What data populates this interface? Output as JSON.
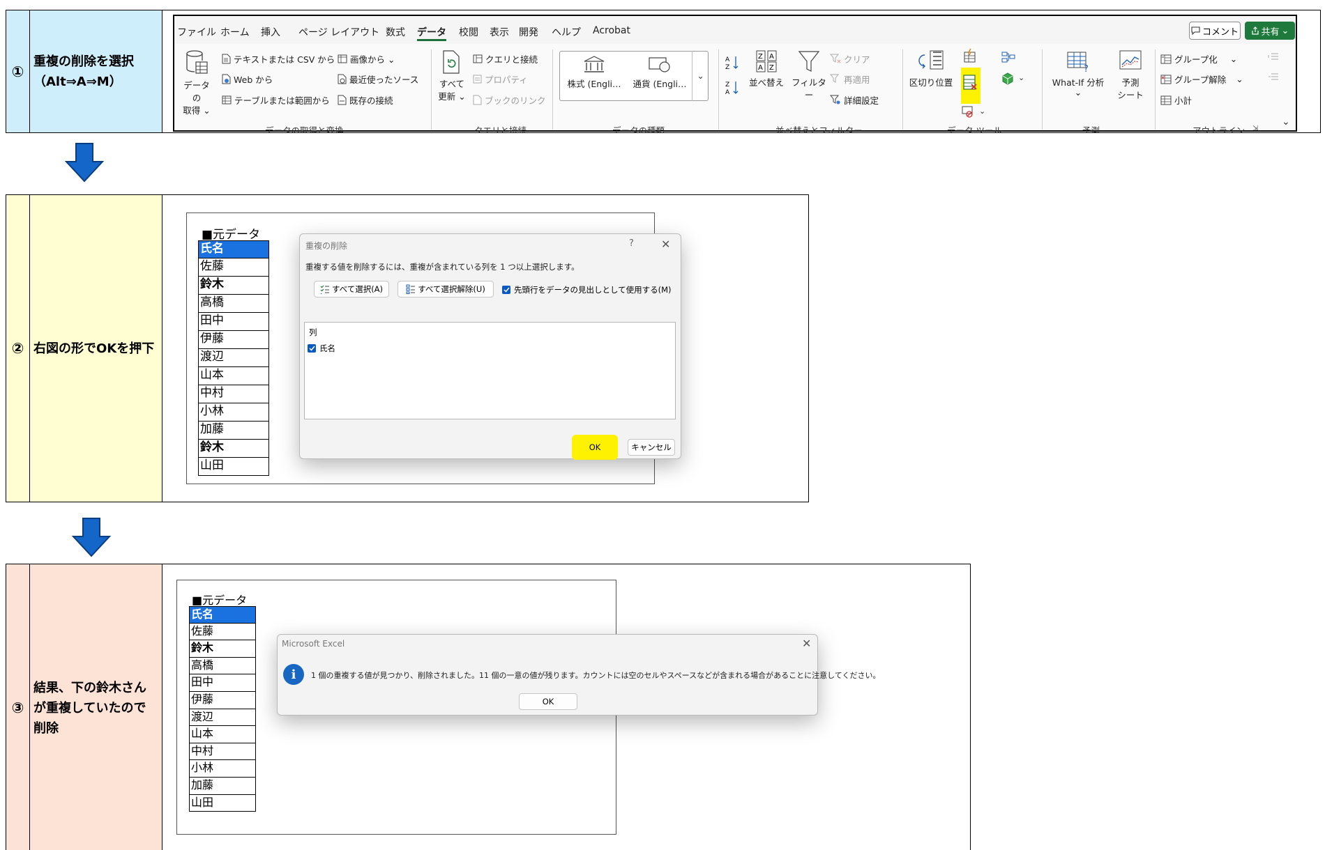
{
  "steps": [
    {
      "num": "①",
      "desc": [
        "重複の削除を選択",
        "（Alt⇒A⇒M）"
      ],
      "bg": "#cdeefa"
    },
    {
      "num": "②",
      "desc": [
        "右図の形でOKを押下"
      ],
      "bg": "#fefed2"
    },
    {
      "num": "③",
      "desc": [
        "結果、下の鈴木さん",
        "が重複していたので",
        "削除"
      ],
      "bg": "#fde2d6"
    }
  ],
  "ribbon": {
    "tabs": [
      "ファイル",
      "ホーム",
      "挿入",
      "ページ レイアウト",
      "数式",
      "データ",
      "校閲",
      "表示",
      "開発",
      "ヘルプ",
      "Acrobat"
    ],
    "active_tab": "データ",
    "comment_label": "コメント",
    "share_label": "共有",
    "get_data": {
      "label1": "データの",
      "label2": "取得 ⌄",
      "text_csv": "テキストまたは CSV から",
      "web": "Web から",
      "table_range": "テーブルまたは範囲から",
      "from_image": "画像から ⌄",
      "recent_sources": "最近使ったソース",
      "existing_conn": "既存の接続",
      "group": "データの取得と変換"
    },
    "queries": {
      "refresh1": "すべて",
      "refresh2": "更新 ⌄",
      "queries_conn": "クエリと接続",
      "properties": "プロパティ",
      "book_links": "ブックのリンク",
      "group": "クエリと接続"
    },
    "data_types": {
      "stocks": "株式 (Engli…",
      "currency": "通貨 (Engli…",
      "group": "データの種類"
    },
    "sort_filter": {
      "sort": "並べ替え",
      "filter": "フィルター",
      "clear": "クリア",
      "reapply": "再適用",
      "advanced": "詳細設定",
      "group": "並べ替えとフィルター"
    },
    "data_tools": {
      "text_to_columns": "区切り位置",
      "group": "データ ツール"
    },
    "forecast": {
      "whatif": "What-If 分析",
      "whatif2": "⌄",
      "sheet1": "予測",
      "sheet2": "シート",
      "group": "予測"
    },
    "outline": {
      "group_btn": "グループ化",
      "ungroup": "グループ解除",
      "subtotal": "小計",
      "group": "アウトライン"
    }
  },
  "sheet2": {
    "title": "■元データ",
    "header": "氏名",
    "rows": [
      "佐藤",
      "鈴木",
      "高橋",
      "田中",
      "伊藤",
      "渡辺",
      "山本",
      "中村",
      "小林",
      "加藤",
      "鈴木",
      "山田"
    ],
    "bold_rows": [
      1,
      10
    ]
  },
  "dialog_remove_dup": {
    "title": "重複の削除",
    "help": "?",
    "close": "✕",
    "instruction": "重複する値を削除するには、重複が含まれている列を 1 つ以上選択します。",
    "select_all": "すべて選択(A)",
    "unselect_all": "すべて選択解除(U)",
    "header_checkbox": "先頭行をデータの見出しとして使用する(M)",
    "column_header": "列",
    "column_item": "氏名",
    "ok": "OK",
    "cancel": "キャンセル"
  },
  "sheet3": {
    "title": "■元データ",
    "header": "氏名",
    "rows": [
      "佐藤",
      "鈴木",
      "高橋",
      "田中",
      "伊藤",
      "渡辺",
      "山本",
      "中村",
      "小林",
      "加藤",
      "山田"
    ],
    "bold_rows": [
      1
    ]
  },
  "dialog_result": {
    "title": "Microsoft Excel",
    "close": "✕",
    "message": "1 個の重複する値が見つかり、削除されました。11 個の一意の値が残ります。カウントには空のセルやスペースなどが含まれる場合があることに注意してください。",
    "ok": "OK"
  },
  "colors": {
    "highlight": "#fff200",
    "arrow": "#1466c8",
    "header_cell": "#1a72e0",
    "excel_green": "#1e7a3c"
  }
}
